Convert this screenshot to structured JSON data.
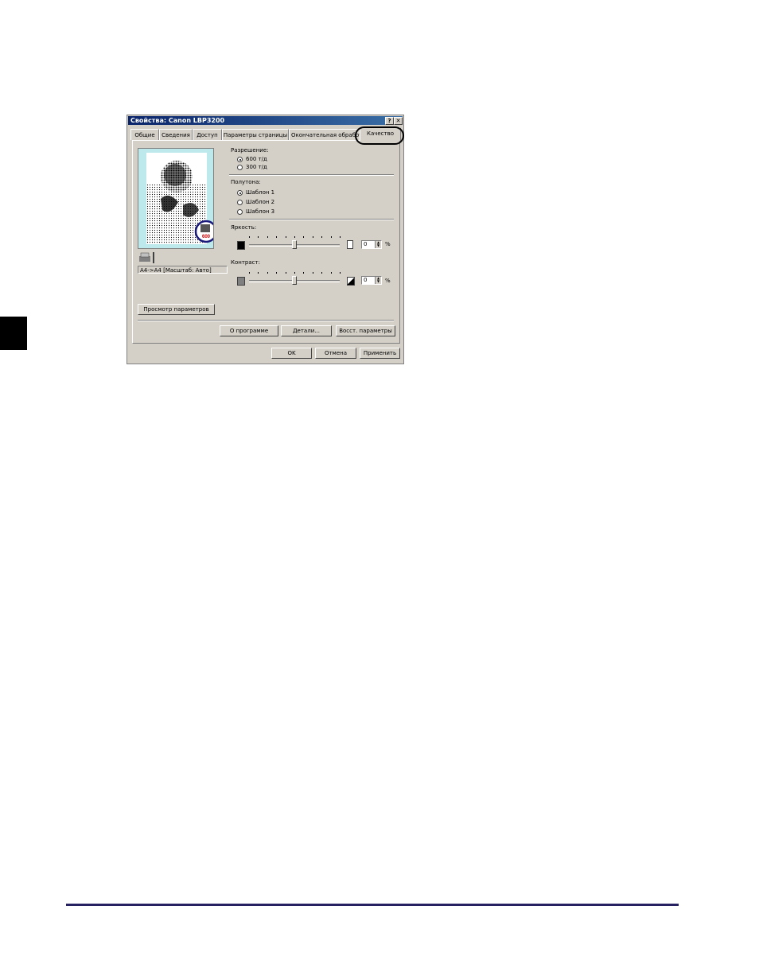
{
  "window": {
    "title": "Свойства: Canon LBP3200",
    "help_btn": "?",
    "close_btn": "✕"
  },
  "tabs": [
    {
      "label": "Общие"
    },
    {
      "label": "Сведения"
    },
    {
      "label": "Доступ"
    },
    {
      "label": "Параметры страницы"
    },
    {
      "label": "Окончательная обработка"
    },
    {
      "label": "Качество"
    }
  ],
  "preview": {
    "badge": "600",
    "caption": "A4->A4 [Масштаб: Авто]"
  },
  "resolution": {
    "label": "Разрешение:",
    "options": [
      "600 т/д",
      "300 т/д"
    ],
    "selected": 0
  },
  "halftone": {
    "label": "Полутона:",
    "options": [
      "Шаблон 1",
      "Шаблон 2",
      "Шаблон 3"
    ],
    "selected": 0
  },
  "brightness": {
    "label": "Яркость:",
    "value": "0",
    "unit": "%",
    "level": 0.5
  },
  "contrast": {
    "label": "Контраст:",
    "value": "0",
    "unit": "%",
    "level": 0.5
  },
  "buttons": {
    "view_settings": "Просмотр параметров",
    "about": "О программе",
    "details": "Детали...",
    "restore": "Восст. параметры",
    "ok": "OK",
    "cancel": "Отмена",
    "apply": "Применить"
  }
}
